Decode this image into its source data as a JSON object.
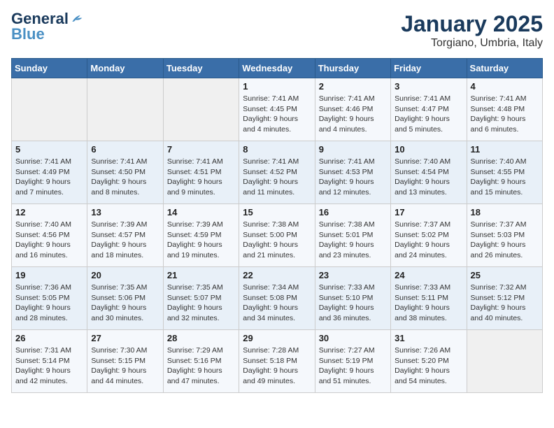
{
  "header": {
    "logo_general": "General",
    "logo_blue": "Blue",
    "month": "January 2025",
    "location": "Torgiano, Umbria, Italy"
  },
  "days_of_week": [
    "Sunday",
    "Monday",
    "Tuesday",
    "Wednesday",
    "Thursday",
    "Friday",
    "Saturday"
  ],
  "weeks": [
    [
      {
        "day": "",
        "detail": ""
      },
      {
        "day": "",
        "detail": ""
      },
      {
        "day": "",
        "detail": ""
      },
      {
        "day": "1",
        "detail": "Sunrise: 7:41 AM\nSunset: 4:45 PM\nDaylight: 9 hours\nand 4 minutes."
      },
      {
        "day": "2",
        "detail": "Sunrise: 7:41 AM\nSunset: 4:46 PM\nDaylight: 9 hours\nand 4 minutes."
      },
      {
        "day": "3",
        "detail": "Sunrise: 7:41 AM\nSunset: 4:47 PM\nDaylight: 9 hours\nand 5 minutes."
      },
      {
        "day": "4",
        "detail": "Sunrise: 7:41 AM\nSunset: 4:48 PM\nDaylight: 9 hours\nand 6 minutes."
      }
    ],
    [
      {
        "day": "5",
        "detail": "Sunrise: 7:41 AM\nSunset: 4:49 PM\nDaylight: 9 hours\nand 7 minutes."
      },
      {
        "day": "6",
        "detail": "Sunrise: 7:41 AM\nSunset: 4:50 PM\nDaylight: 9 hours\nand 8 minutes."
      },
      {
        "day": "7",
        "detail": "Sunrise: 7:41 AM\nSunset: 4:51 PM\nDaylight: 9 hours\nand 9 minutes."
      },
      {
        "day": "8",
        "detail": "Sunrise: 7:41 AM\nSunset: 4:52 PM\nDaylight: 9 hours\nand 11 minutes."
      },
      {
        "day": "9",
        "detail": "Sunrise: 7:41 AM\nSunset: 4:53 PM\nDaylight: 9 hours\nand 12 minutes."
      },
      {
        "day": "10",
        "detail": "Sunrise: 7:40 AM\nSunset: 4:54 PM\nDaylight: 9 hours\nand 13 minutes."
      },
      {
        "day": "11",
        "detail": "Sunrise: 7:40 AM\nSunset: 4:55 PM\nDaylight: 9 hours\nand 15 minutes."
      }
    ],
    [
      {
        "day": "12",
        "detail": "Sunrise: 7:40 AM\nSunset: 4:56 PM\nDaylight: 9 hours\nand 16 minutes."
      },
      {
        "day": "13",
        "detail": "Sunrise: 7:39 AM\nSunset: 4:57 PM\nDaylight: 9 hours\nand 18 minutes."
      },
      {
        "day": "14",
        "detail": "Sunrise: 7:39 AM\nSunset: 4:59 PM\nDaylight: 9 hours\nand 19 minutes."
      },
      {
        "day": "15",
        "detail": "Sunrise: 7:38 AM\nSunset: 5:00 PM\nDaylight: 9 hours\nand 21 minutes."
      },
      {
        "day": "16",
        "detail": "Sunrise: 7:38 AM\nSunset: 5:01 PM\nDaylight: 9 hours\nand 23 minutes."
      },
      {
        "day": "17",
        "detail": "Sunrise: 7:37 AM\nSunset: 5:02 PM\nDaylight: 9 hours\nand 24 minutes."
      },
      {
        "day": "18",
        "detail": "Sunrise: 7:37 AM\nSunset: 5:03 PM\nDaylight: 9 hours\nand 26 minutes."
      }
    ],
    [
      {
        "day": "19",
        "detail": "Sunrise: 7:36 AM\nSunset: 5:05 PM\nDaylight: 9 hours\nand 28 minutes."
      },
      {
        "day": "20",
        "detail": "Sunrise: 7:35 AM\nSunset: 5:06 PM\nDaylight: 9 hours\nand 30 minutes."
      },
      {
        "day": "21",
        "detail": "Sunrise: 7:35 AM\nSunset: 5:07 PM\nDaylight: 9 hours\nand 32 minutes."
      },
      {
        "day": "22",
        "detail": "Sunrise: 7:34 AM\nSunset: 5:08 PM\nDaylight: 9 hours\nand 34 minutes."
      },
      {
        "day": "23",
        "detail": "Sunrise: 7:33 AM\nSunset: 5:10 PM\nDaylight: 9 hours\nand 36 minutes."
      },
      {
        "day": "24",
        "detail": "Sunrise: 7:33 AM\nSunset: 5:11 PM\nDaylight: 9 hours\nand 38 minutes."
      },
      {
        "day": "25",
        "detail": "Sunrise: 7:32 AM\nSunset: 5:12 PM\nDaylight: 9 hours\nand 40 minutes."
      }
    ],
    [
      {
        "day": "26",
        "detail": "Sunrise: 7:31 AM\nSunset: 5:14 PM\nDaylight: 9 hours\nand 42 minutes."
      },
      {
        "day": "27",
        "detail": "Sunrise: 7:30 AM\nSunset: 5:15 PM\nDaylight: 9 hours\nand 44 minutes."
      },
      {
        "day": "28",
        "detail": "Sunrise: 7:29 AM\nSunset: 5:16 PM\nDaylight: 9 hours\nand 47 minutes."
      },
      {
        "day": "29",
        "detail": "Sunrise: 7:28 AM\nSunset: 5:18 PM\nDaylight: 9 hours\nand 49 minutes."
      },
      {
        "day": "30",
        "detail": "Sunrise: 7:27 AM\nSunset: 5:19 PM\nDaylight: 9 hours\nand 51 minutes."
      },
      {
        "day": "31",
        "detail": "Sunrise: 7:26 AM\nSunset: 5:20 PM\nDaylight: 9 hours\nand 54 minutes."
      },
      {
        "day": "",
        "detail": ""
      }
    ]
  ]
}
